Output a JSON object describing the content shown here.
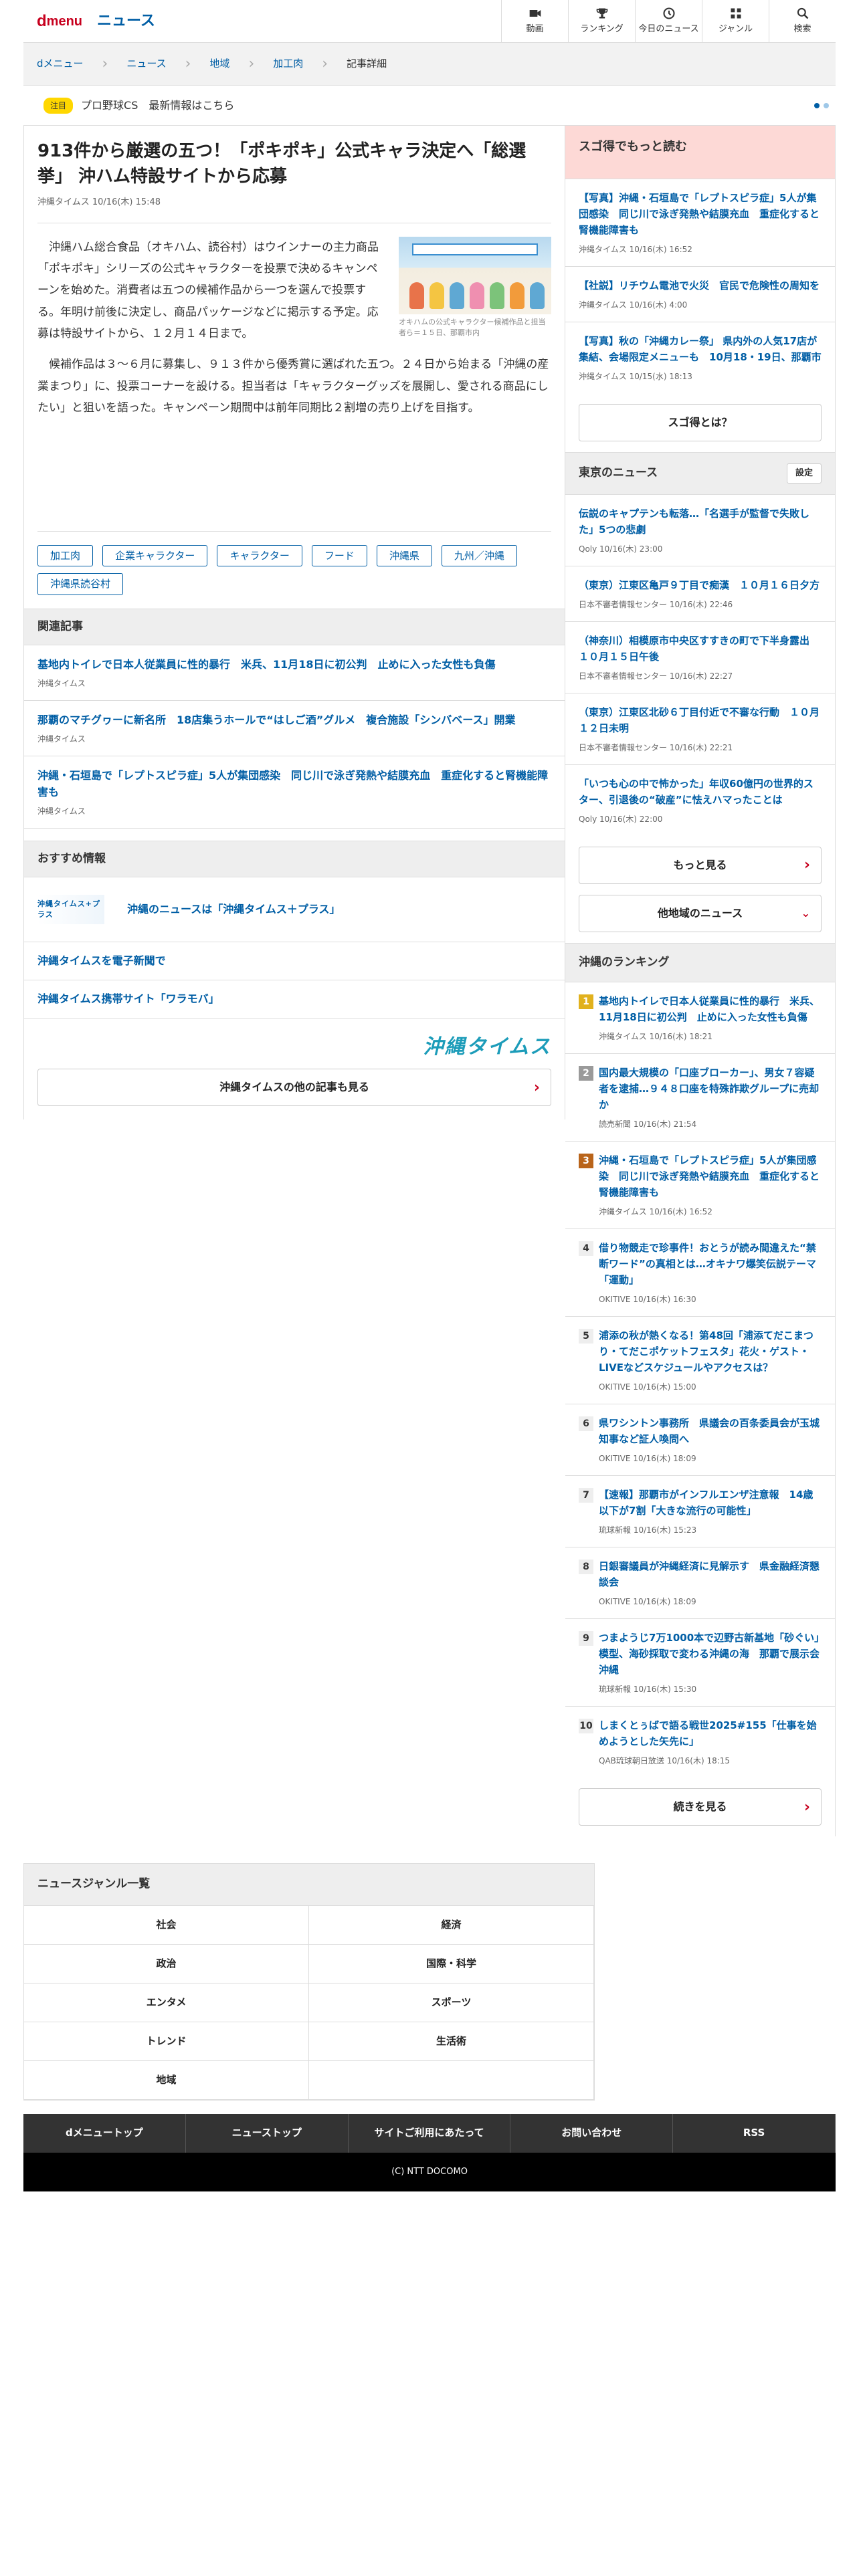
{
  "header": {
    "logo_d": "d",
    "logo_menu": "menu",
    "section": "ニュース",
    "nav": [
      {
        "label": "動画",
        "icon": "video-icon"
      },
      {
        "label": "ランキング",
        "icon": "trophy-icon"
      },
      {
        "label": "今日のニュース",
        "icon": "clock-icon"
      },
      {
        "label": "ジャンル",
        "icon": "grid-icon"
      },
      {
        "label": "検索",
        "icon": "search-icon"
      }
    ]
  },
  "breadcrumb": [
    "dメニュー",
    "ニュース",
    "地域",
    "加工肉",
    "記事詳細"
  ],
  "ticker": {
    "tag": "注目",
    "text": "プロ野球CS　最新情報はこちら"
  },
  "article": {
    "title": "913件から厳選の五つ！「ポキポキ」公式キャラ決定へ「総選挙」 沖ハム特設サイトから応募",
    "meta": "沖縄タイムス 10/16(木) 15:48",
    "fig_caption": "オキハムの公式キャラクター候補作品と担当者ら＝１５日、那覇市内",
    "p1": "沖縄ハム総合食品（オキハム、読谷村）はウインナーの主力商品「ポキポキ」シリーズの公式キャラクターを投票で決めるキャンペーンを始めた。消費者は五つの候補作品から一つを選んで投票する。年明け前後に決定し、商品パッケージなどに掲示する予定。応募は特設サイトから、１２月１４日まで。",
    "p2": "候補作品は３～６月に募集し、９１３件から優秀賞に選ばれた五つ。２４日から始まる「沖縄の産業まつり」に、投票コーナーを設ける。担当者は「キャラクターグッズを展開し、愛される商品にしたい」と狙いを語った。キャンペーン期間中は前年同期比２割増の売り上げを目指す。",
    "tags": [
      "加工肉",
      "企業キャラクター",
      "キャラクター",
      "フード",
      "沖縄県",
      "九州／沖縄",
      "沖縄県読谷村"
    ]
  },
  "related": {
    "heading": "関連記事",
    "items": [
      {
        "title": "基地内トイレで日本人従業員に性的暴行　米兵、11月18日に初公判　止めに入った女性も負傷",
        "source": "沖縄タイムス"
      },
      {
        "title": "那覇のマチグヮーに新名所　18店集うホールで“はしご酒”グルメ　複合施設「シンバベース」開業",
        "source": "沖縄タイムス"
      },
      {
        "title": "沖縄・石垣島で「レプトスピラ症」5人が集団感染　同じ川で泳ぎ発熱や結膜充血　重症化すると腎機能障害も",
        "source": "沖縄タイムス"
      }
    ]
  },
  "recommend": {
    "heading": "おすすめ情報",
    "logo_text": "沖縄タイムス+プラス",
    "items": [
      "沖縄のニュースは「沖縄タイムス＋プラス」",
      "沖縄タイムスを電子新聞で",
      "沖縄タイムス携帯サイト「ワラモバ」"
    ]
  },
  "publisher_logo": "沖縄タイムス",
  "more_articles": "沖縄タイムスの他の記事も見る",
  "sidebar": {
    "sugotoku": {
      "heading": "スゴ得でもっと読む",
      "items": [
        {
          "title": "【写真】沖縄・石垣島で「レプトスピラ症」5人が集団感染　同じ川で泳ぎ発熱や結膜充血　重症化すると腎機能障害も",
          "source": "沖縄タイムス 10/16(木) 16:52"
        },
        {
          "title": "【社説】リチウム電池で火災　官民で危険性の周知を",
          "source": "沖縄タイムス 10/16(木) 4:00"
        },
        {
          "title": "【写真】秋の「沖縄カレー祭」 県内外の人気17店が集結、会場限定メニューも　10月18・19日、那覇市",
          "source": "沖縄タイムス 10/15(水) 18:13"
        }
      ],
      "button": "スゴ得とは？"
    },
    "tokyo": {
      "heading": "東京のニュース",
      "settings": "設定",
      "items": [
        {
          "title": "伝説のキャプテンも転落…「名選手が監督で失敗した」5つの悲劇",
          "source": "Qoly 10/16(木) 23:00"
        },
        {
          "title": "（東京）江東区亀戸９丁目で痴漢　１０月１６日夕方",
          "source": "日本不審者情報センター 10/16(木) 22:46"
        },
        {
          "title": "（神奈川）相模原市中央区すすきの町で下半身露出　１０月１５日午後",
          "source": "日本不審者情報センター 10/16(木) 22:27"
        },
        {
          "title": "（東京）江東区北砂６丁目付近で不審な行動　１０月１２日未明",
          "source": "日本不審者情報センター 10/16(木) 22:21"
        },
        {
          "title": "「いつも心の中で怖かった」年収60億円の世界的スター、引退後の“破産”に怯えハマったことは",
          "source": "Qoly 10/16(木) 22:00"
        }
      ],
      "more": "もっと見る",
      "other": "他地域のニュース"
    },
    "ranking": {
      "heading": "沖縄のランキング",
      "items": [
        {
          "no": "1",
          "title": "基地内トイレで日本人従業員に性的暴行　米兵、11月18日に初公判　止めに入った女性も負傷",
          "source": "沖縄タイムス 10/16(木) 18:21"
        },
        {
          "no": "2",
          "title": "国内最大規模の「口座ブローカー」、男女７容疑者を逮捕…９４８口座を特殊詐欺グループに売却か",
          "source": "読売新聞 10/16(木) 21:54"
        },
        {
          "no": "3",
          "title": "沖縄・石垣島で「レプトスピラ症」5人が集団感染　同じ川で泳ぎ発熱や結膜充血　重症化すると腎機能障害も",
          "source": "沖縄タイムス 10/16(木) 16:52"
        },
        {
          "no": "4",
          "title": "借り物競走で珍事件！おとうが読み間違えた“禁断ワード”の真相とは…オキナワ爆笑伝説テーマ「運動」",
          "source": "OKITIVE 10/16(木) 16:30"
        },
        {
          "no": "5",
          "title": "浦添の秋が熱くなる！第48回「浦添てだこまつり・てだこポケットフェスタ」花火・ゲスト・LIVEなどスケジュールやアクセスは？",
          "source": "OKITIVE 10/16(木) 15:00"
        },
        {
          "no": "6",
          "title": "県ワシントン事務所　県議会の百条委員会が玉城知事など証人喚問へ",
          "source": "OKITIVE 10/16(木) 18:09"
        },
        {
          "no": "7",
          "title": "【速報】那覇市がインフルエンザ注意報　14歳以下が7割「大きな流行の可能性」",
          "source": "琉球新報 10/16(木) 15:23"
        },
        {
          "no": "8",
          "title": "日銀審議員が沖縄経済に見解示す　県金融経済懇談会",
          "source": "OKITIVE 10/16(木) 18:09"
        },
        {
          "no": "9",
          "title": "つまようじ7万1000本で辺野古新基地「砂ぐい」模型、海砂採取で変わる沖縄の海　那覇で展示会　沖縄",
          "source": "琉球新報 10/16(木) 15:30"
        },
        {
          "no": "10",
          "title": "しまくとぅばで語る戦世2025#155「仕事を始めようとした矢先に」",
          "source": "QAB琉球朝日放送 10/16(木) 18:15"
        }
      ],
      "more": "続きを見る"
    }
  },
  "genre": {
    "heading": "ニュースジャンル一覧",
    "items": [
      "社会",
      "経済",
      "政治",
      "国際・科学",
      "エンタメ",
      "スポーツ",
      "トレンド",
      "生活術",
      "地域"
    ]
  },
  "footer": {
    "nav": [
      "dメニュートップ",
      "ニューストップ",
      "サイトご利用にあたって",
      "お問い合わせ",
      "RSS"
    ],
    "copyright": "(C) NTT DOCOMO"
  },
  "colors": {
    "brand": "#c7001e",
    "link": "#005ea5",
    "highlight": "#fdd9d6"
  }
}
